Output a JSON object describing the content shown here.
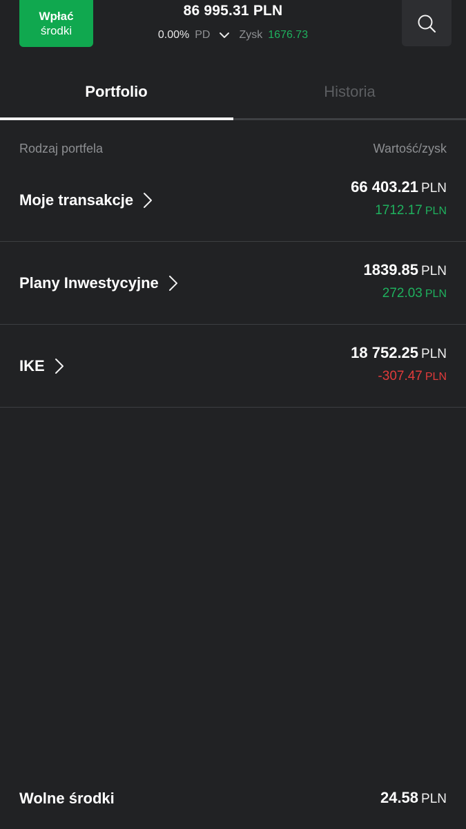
{
  "header": {
    "deposit_line1": "Wpłać",
    "deposit_line2": "środki",
    "total_value": "86 995.31 PLN",
    "change_percent": "0.00%",
    "period": "PD",
    "profit_label": "Zysk",
    "profit_value": "1676.73",
    "search_icon": "search-icon"
  },
  "tabs": {
    "active": "Portfolio",
    "inactive": "Historia"
  },
  "list": {
    "col_left": "Rodzaj portfela",
    "col_right": "Wartość/zysk",
    "rows": [
      {
        "name": "Moje transakcje",
        "value": "66 403.21",
        "currency": "PLN",
        "gain": "1712.17",
        "gain_currency": "PLN",
        "gain_status": "positive"
      },
      {
        "name": "Plany Inwestycyjne",
        "value": "1839.85",
        "currency": "PLN",
        "gain": "272.03",
        "gain_currency": "PLN",
        "gain_status": "positive"
      },
      {
        "name": "IKE",
        "value": "18 752.25",
        "currency": "PLN",
        "gain": "-307.47",
        "gain_currency": "PLN",
        "gain_status": "negative"
      }
    ]
  },
  "footer": {
    "label": "Wolne środki",
    "value": "24.58",
    "currency": "PLN"
  },
  "colors": {
    "background": "#212224",
    "accent_green": "#10a84f",
    "positive": "#1fb15e",
    "negative": "#e23b3b"
  }
}
